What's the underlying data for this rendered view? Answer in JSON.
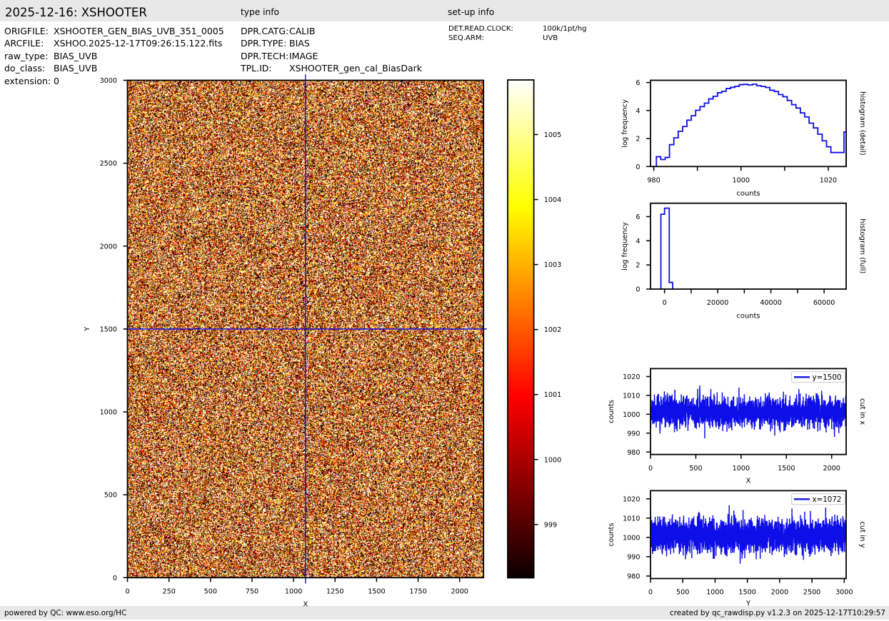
{
  "colors": {
    "bar_bg": "#e8e8e8",
    "line_blue": "#0e0ee8",
    "frame": "#000000",
    "legend_edge": "#cccccc"
  },
  "header": {
    "title": "2025-12-16: XSHOOTER",
    "type_info_heading": "type info",
    "setup_info_heading": "set-up info",
    "file_info": [
      {
        "label": "ORIGFILE:",
        "value": "XSHOOTER_GEN_BIAS_UVB_351_0005"
      },
      {
        "label": "ARCFILE:",
        "value": "XSHOO.2025-12-17T09:26:15.122.fits"
      },
      {
        "label": "raw_type:",
        "value": "BIAS_UVB"
      },
      {
        "label": "do_class:",
        "value": "BIAS_UVB"
      },
      {
        "label": "extension:",
        "value": "0"
      }
    ],
    "type_info": [
      {
        "label": "DPR.CATG:",
        "value": "CALIB"
      },
      {
        "label": "DPR.TYPE:",
        "value": "BIAS"
      },
      {
        "label": "DPR.TECH:",
        "value": "IMAGE"
      },
      {
        "label": "TPL.ID:",
        "value": "XSHOOTER_gen_cal_BiasDark"
      }
    ],
    "setup_info": [
      {
        "label": "DET.READ.CLOCK:",
        "value": "100k/1pt/hg"
      },
      {
        "label": "SEQ.ARM:",
        "value": "UVB"
      }
    ]
  },
  "footer": {
    "left": "powered by QC: www.eso.org/HC",
    "right": "created by qc_rawdisp.py v1.2.3 on 2025-12-17T10:29:57"
  },
  "chart_data": [
    {
      "id": "raw_image",
      "type": "heatmap",
      "xlabel": "X",
      "ylabel": "Y",
      "xlim": [
        0,
        2144
      ],
      "ylim": [
        0,
        3000
      ],
      "xticks": [
        0,
        250,
        500,
        750,
        1000,
        1250,
        1500,
        1750,
        2000
      ],
      "yticks": [
        0,
        500,
        1000,
        1500,
        2000,
        2500,
        3000
      ],
      "colormap": "hot",
      "vmin": 998.18,
      "vmax": 1005.84,
      "noise": {
        "mean": 1002.1,
        "sigma": 4.3,
        "seed": 42
      },
      "crosshair": {
        "x": 1072,
        "y": 1500
      }
    },
    {
      "id": "colorbar",
      "type": "colorbar",
      "colormap": "hot",
      "vmin": 998.18,
      "vmax": 1005.84,
      "ticks": [
        999,
        1000,
        1001,
        1002,
        1003,
        1004,
        1005
      ]
    },
    {
      "id": "hist_detail",
      "type": "line",
      "mode": "step-histogram",
      "xlabel": "counts",
      "ylabel": "log frequency",
      "right_label": "histogram (detail)",
      "xlim": [
        979.25,
        1024.1
      ],
      "ylim": [
        0,
        6.16
      ],
      "xticks": [
        980,
        990,
        1000,
        1010,
        1020
      ],
      "xtick_labels": [
        980,
        1000,
        1020
      ],
      "yticks": [
        0,
        2,
        4,
        6
      ],
      "bin_start": 980.6,
      "bin_width": 1,
      "values": [
        0.7,
        0.5,
        0.65,
        1.56,
        2.05,
        2.52,
        2.86,
        3.31,
        3.63,
        4.02,
        4.28,
        4.53,
        4.83,
        5.02,
        5.27,
        5.37,
        5.57,
        5.66,
        5.73,
        5.85,
        5.87,
        5.83,
        5.88,
        5.77,
        5.72,
        5.65,
        5.45,
        5.36,
        5.14,
        4.99,
        4.72,
        4.42,
        4.18,
        3.83,
        3.54,
        3.1,
        2.76,
        2.31,
        1.84,
        1.41,
        1.0,
        1.0,
        1.0
      ],
      "last_bin_value": 2.47
    },
    {
      "id": "hist_full",
      "type": "line",
      "mode": "step-histogram",
      "xlabel": "counts",
      "ylabel": "log frequency",
      "right_label": "histogram (full)",
      "xlim": [
        -5280,
        68300
      ],
      "ylim": [
        0,
        7.11
      ],
      "xticks": [
        0,
        10000,
        20000,
        30000,
        40000,
        50000,
        60000
      ],
      "xtick_labels": [
        0,
        20000,
        40000,
        60000
      ],
      "yticks": [
        0,
        2,
        4,
        6
      ],
      "steps": [
        {
          "x0": -1370,
          "x1": 0,
          "v": 6.2
        },
        {
          "x0": 0,
          "x1": 1770,
          "v": 6.7
        },
        {
          "x0": 1770,
          "x1": 3060,
          "v": 0.55
        }
      ]
    },
    {
      "id": "cut_x",
      "type": "line",
      "mode": "noise-trace",
      "xlabel": "X",
      "ylabel": "counts",
      "right_label": "cut in x",
      "legend": "y=1500",
      "xlim": [
        0,
        2160
      ],
      "ylim": [
        978.7,
        1024.2
      ],
      "xticks": [
        0,
        500,
        1000,
        1500,
        2000
      ],
      "yticks": [
        980,
        990,
        1000,
        1010,
        1020
      ],
      "noise": {
        "n": 2144,
        "mean": 1001.3,
        "sigma": 4.05,
        "seed": 11
      }
    },
    {
      "id": "cut_y",
      "type": "line",
      "mode": "noise-trace",
      "xlabel": "Y",
      "ylabel": "counts",
      "right_label": "cut in y",
      "legend": "x=1072",
      "xlim": [
        0,
        3030
      ],
      "ylim": [
        978.7,
        1024.2
      ],
      "xticks": [
        0,
        500,
        1000,
        1500,
        2000,
        2500,
        3000
      ],
      "yticks": [
        980,
        990,
        1000,
        1010,
        1020
      ],
      "noise": {
        "n": 3000,
        "mean": 1001.3,
        "sigma": 4.05,
        "seed": 12
      }
    }
  ]
}
